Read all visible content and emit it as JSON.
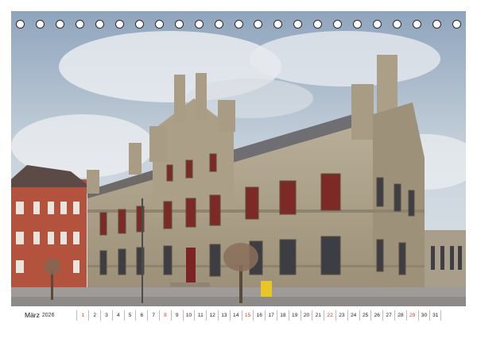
{
  "calendar": {
    "month": "März",
    "year": "2026",
    "days": [
      "1",
      "2",
      "3",
      "4",
      "5",
      "6",
      "7",
      "8",
      "9",
      "10",
      "11",
      "12",
      "13",
      "14",
      "15",
      "16",
      "17",
      "18",
      "19",
      "20",
      "21",
      "22",
      "23",
      "24",
      "25",
      "26",
      "27",
      "28",
      "29",
      "30",
      "31"
    ],
    "sunday_days": [
      "1",
      "8",
      "15",
      "22",
      "29"
    ],
    "sunday_color": "#d23a2f",
    "ring_count": 23
  },
  "photo": {
    "subject": "historic sandstone building",
    "sky_color": "#9fb3c7",
    "stone_color": "#a89c83",
    "brick_color": "#b5553f"
  }
}
